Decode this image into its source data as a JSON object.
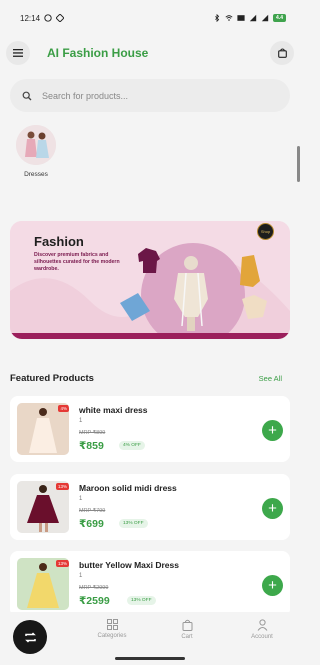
{
  "status_bar": {
    "time": "12:14",
    "battery": "4.4"
  },
  "app": {
    "title": "AI Fashion House"
  },
  "search": {
    "placeholder": "Search for products..."
  },
  "categories": [
    {
      "label": "Dresses"
    }
  ],
  "banner": {
    "title": "Fashion",
    "subtitle": "Discover premium fabrics and silhouettes curated for the modern wardrobe.",
    "logo_text": "Shop"
  },
  "featured": {
    "title": "Featured Products",
    "see_all": "See All"
  },
  "products": [
    {
      "name": "white maxi dress",
      "qty": "1",
      "mrp": "MRP ₹899",
      "price": "₹859",
      "off": "4% OFF",
      "badge": "4%"
    },
    {
      "name": "Maroon solid midi dress",
      "qty": "1",
      "mrp": "MRP ₹799",
      "price": "₹699",
      "off": "13% OFF",
      "badge": "13%"
    },
    {
      "name": "butter Yellow Maxi Dress",
      "qty": "1",
      "mrp": "MRP ₹2999",
      "price": "₹2599",
      "off": "13% OFF",
      "badge": "13%"
    }
  ],
  "nav": {
    "categories": "Categories",
    "cart": "Cart",
    "account": "Account"
  },
  "colors": {
    "accent": "#3a9d45",
    "badge": "#e53935",
    "banner_bg": "#f3d9e3"
  }
}
